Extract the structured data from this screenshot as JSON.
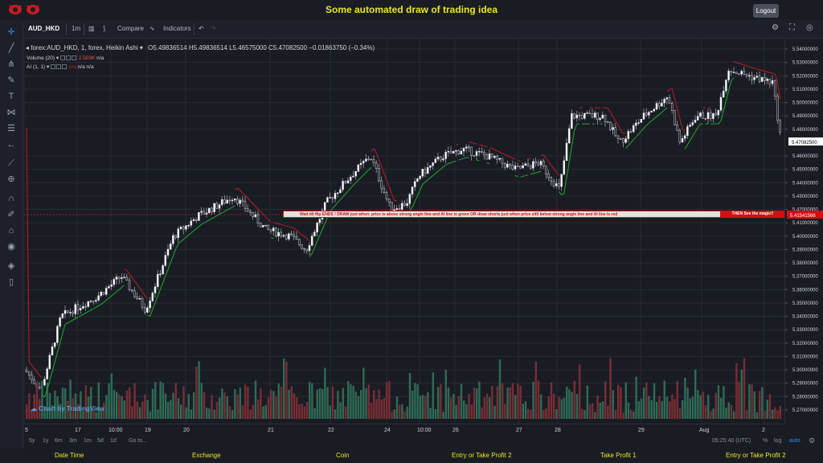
{
  "header": {
    "title": "Some automated draw of trading idea",
    "logout": "Logout"
  },
  "toolbar": {
    "symbol": "AUD_HKD",
    "interval": "1m",
    "compare": "Compare",
    "indicators": "Indicators"
  },
  "legend": {
    "main": "forex:AUD_HKD, 1, forex, Heikin Ashi",
    "ohlc": "O5.49836514  H5.49836514  L5.46575000  C5.47082500  −0.01863750 (−0.34%)",
    "volume_label": "Volume (20)",
    "volume_value": "2.503K",
    "volume_na": "n/a",
    "ai_label": "AI (1, 1)",
    "ai_val1": "n/a",
    "ai_val2": "n/a",
    "ai_val3": "n/a"
  },
  "annotation": {
    "banner_left": "Wait till flip ENDS  !   DRAW just when:  price is above strong angle line and AI line is green         OR          draw shorts just when price still below strong angle line and AI line is red",
    "banner_right": "THEN See the magic!!",
    "price_tag": "5.41541566"
  },
  "price_axis": {
    "labels": [
      "5.54000000",
      "5.53000000",
      "5.52000000",
      "5.51000000",
      "5.50000000",
      "5.49000000",
      "5.48000000",
      "5.47082500",
      "5.46000000",
      "5.45000000",
      "5.44000000",
      "5.43000000",
      "5.42000000",
      "5.41000000",
      "5.40000000",
      "5.39000000",
      "5.38000000",
      "5.37000000",
      "5.36000000",
      "5.35000000",
      "5.34000000",
      "5.33000000",
      "5.32000000",
      "5.31000000",
      "5.30000000",
      "5.29000000",
      "5.28000000",
      "5.27000000"
    ],
    "current": "5.47082500"
  },
  "time_axis": {
    "labels": [
      "5",
      "17",
      "10:00",
      "19",
      "20",
      "21",
      "22",
      "24",
      "10:00",
      "26",
      "27",
      "28",
      "29",
      "Aug",
      "2"
    ]
  },
  "bottom": {
    "ranges": [
      "5y",
      "1y",
      "6m",
      "3m",
      "1m",
      "5d",
      "1d"
    ],
    "goto": "Go to...",
    "clock": "05:25:40 (UTC)",
    "pct": "%",
    "log": "log",
    "auto": "auto"
  },
  "watermark": "Chart by TradingView",
  "footer": {
    "cols": [
      "Date Time",
      "Exchange",
      "Coin",
      "Entry or Take Profit 2",
      "Take Profit 1",
      "Entry or Take Profit 2"
    ]
  },
  "colors": {
    "accent_yellow": "#e8e62a",
    "up": "#26a69a",
    "down": "#ef5350",
    "ai_green": "#1ea02a",
    "ai_red": "#b31d1d",
    "banner_red": "#d10f14"
  }
}
